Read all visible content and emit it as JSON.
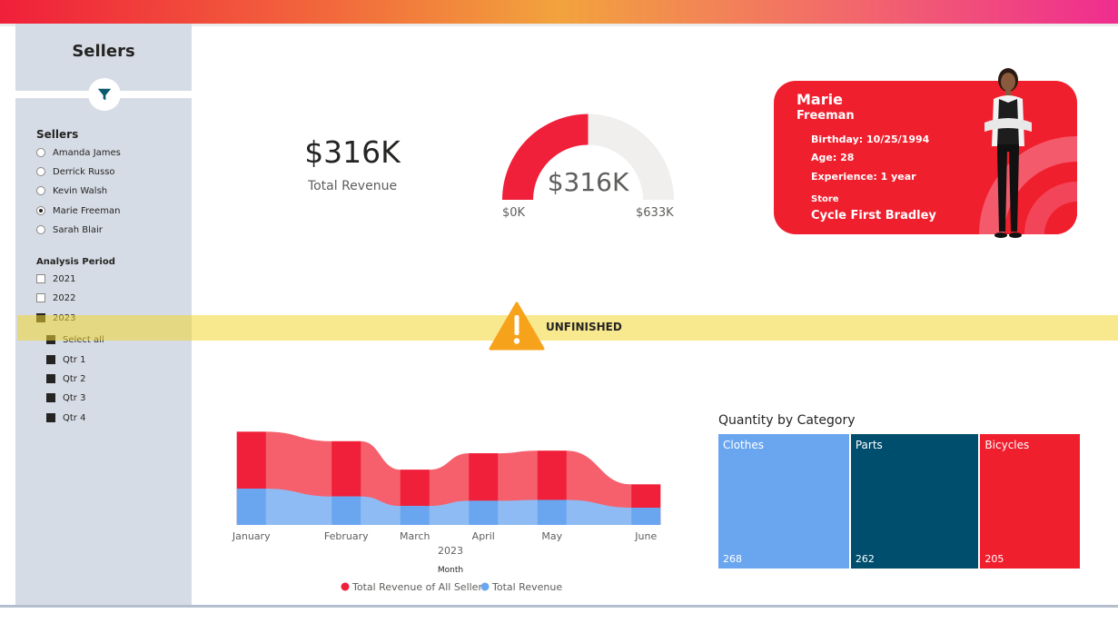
{
  "sidebar": {
    "title": "Sellers",
    "sellers_label": "Sellers",
    "sellers": [
      {
        "name": "Amanda James",
        "selected": false
      },
      {
        "name": "Derrick Russo",
        "selected": false
      },
      {
        "name": "Kevin Walsh",
        "selected": false
      },
      {
        "name": "Marie Freeman",
        "selected": true
      },
      {
        "name": "Sarah Blair",
        "selected": false
      }
    ],
    "period_label": "Analysis Period",
    "years": [
      {
        "label": "2021",
        "checked": false
      },
      {
        "label": "2022",
        "checked": false
      },
      {
        "label": "2023",
        "checked": true
      }
    ],
    "quarters": [
      {
        "label": "Select all",
        "checked": true
      },
      {
        "label": "Qtr 1",
        "checked": true
      },
      {
        "label": "Qtr 2",
        "checked": true
      },
      {
        "label": "Qtr 3",
        "checked": true
      },
      {
        "label": "Qtr 4",
        "checked": true
      }
    ]
  },
  "warning": {
    "text": "UNFINISHED"
  },
  "kpi": {
    "value": "$316K",
    "label": "Total Revenue"
  },
  "gauge": {
    "value": "$316K",
    "min": "$0K",
    "max": "$633K",
    "fill_fraction": 0.5
  },
  "seller_card": {
    "first_name": "Marie",
    "last_name": "Freeman",
    "birthday": "Birthday: 10/25/1994",
    "age": "Age: 28",
    "experience": "Experience: 1 year",
    "store_label": "Store",
    "store": "Cycle First Bradley"
  },
  "chart_data": [
    {
      "type": "area",
      "categories": [
        "January",
        "February",
        "March",
        "April",
        "May",
        "June"
      ],
      "year_label": "2023",
      "xlabel": "Month",
      "series": [
        {
          "name": "Total Revenue of All Sellers",
          "values": [
            108,
            97,
            64,
            83,
            86,
            47
          ],
          "color": "#f01f3a"
        },
        {
          "name": "Total Revenue",
          "values": [
            42,
            33,
            22,
            28,
            29,
            20
          ],
          "color": "#6aa6f0"
        }
      ],
      "legend_position": "bottom"
    },
    {
      "type": "treemap",
      "title": "Quantity by Category",
      "categories": [
        "Clothes",
        "Parts",
        "Bicycles"
      ],
      "values": [
        268,
        262,
        205
      ],
      "colors": [
        "#6aa6f0",
        "#004e6e",
        "#f01f2e"
      ]
    }
  ],
  "colors": {
    "accent_red": "#f01f2e",
    "accent_blue": "#6aa6f0",
    "sidebar_bg": "#d6dce5"
  }
}
